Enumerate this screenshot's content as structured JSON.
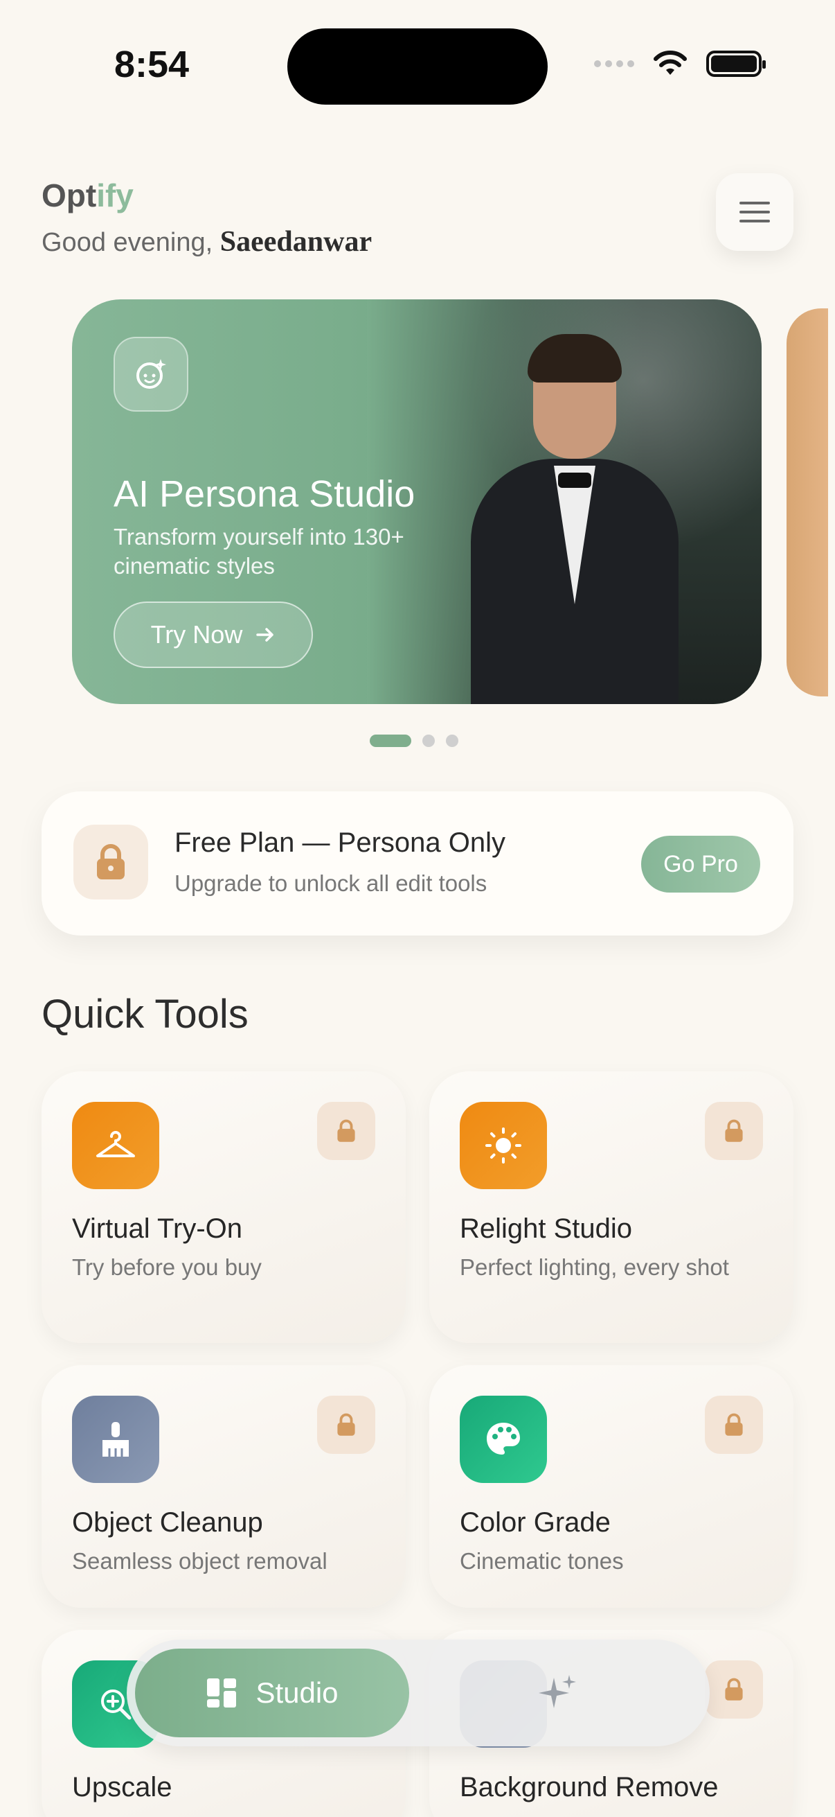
{
  "status": {
    "time": "8:54"
  },
  "header": {
    "brand_part1": "Opt",
    "brand_part2": "ify",
    "greeting": "Good evening, ",
    "user_name": "Saeedanwar"
  },
  "hero": {
    "title": "AI Persona Studio",
    "subtitle": "Transform yourself into 130+ cinematic styles",
    "button": "Try Now",
    "pages": 3,
    "active_page": 1
  },
  "plan": {
    "title": "Free Plan — Persona Only",
    "subtitle": "Upgrade to unlock all edit tools",
    "button": "Go Pro"
  },
  "quick_tools": {
    "title": "Quick Tools",
    "items": [
      {
        "name": "Virtual Try-On",
        "desc": "Try before you buy",
        "icon": "hanger-icon",
        "color": "#ef8a12",
        "locked": true
      },
      {
        "name": "Relight Studio",
        "desc": "Perfect lighting, every shot",
        "icon": "sun-icon",
        "color": "#ef8a12",
        "locked": true
      },
      {
        "name": "Object Cleanup",
        "desc": "Seamless object removal",
        "icon": "brush-icon",
        "color": "#6f7f9d",
        "locked": true
      },
      {
        "name": "Color Grade",
        "desc": "Cinematic tones",
        "icon": "palette-icon",
        "color": "#18a978",
        "locked": true
      },
      {
        "name": "Upscale",
        "desc": "",
        "icon": "zoom-in-icon",
        "color": "#18a978",
        "locked": true
      },
      {
        "name": "Background Remove",
        "desc": "",
        "icon": "background-icon",
        "color": "#6f7f9d",
        "locked": true
      }
    ]
  },
  "nav": {
    "studio": "Studio"
  }
}
